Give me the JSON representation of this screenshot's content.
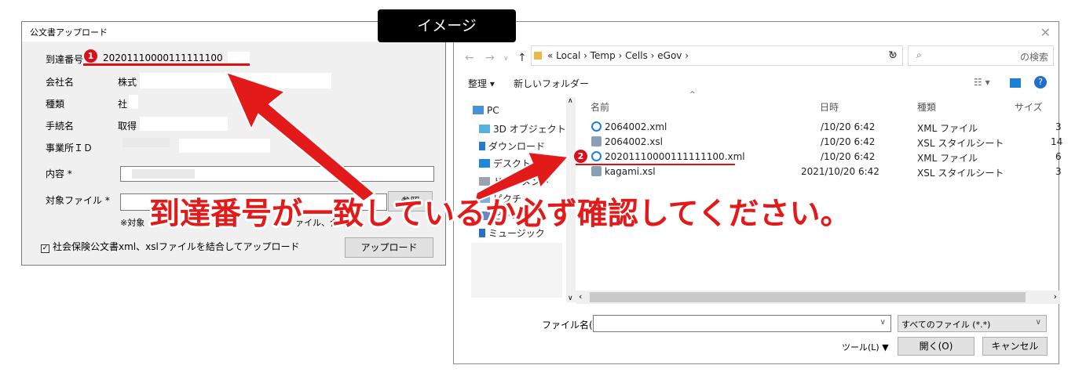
{
  "overlay": {
    "image_tag": "イメージ",
    "headline": "到達番号が一致しているか必ず確認してください。",
    "badge1": "1",
    "badge2": "2"
  },
  "form": {
    "title": "公文書アップロード",
    "arrival_label": "到達番号",
    "arrival_value": "20201110000111111100",
    "company_label": "会社名",
    "company_value": "株式",
    "type_label": "種類",
    "type_value": "社",
    "procedure_label": "手続名",
    "procedure_value": "取得",
    "office_label": "事業所ＩＤ",
    "content_label": "内容 *",
    "target_label": "対象ファイル *",
    "browse_button": "参照",
    "note_left": "※対象",
    "note_right": "ァイル、合計",
    "merge_checkbox_label": "社会保険公文書xml、xslファイルを結合してアップロード",
    "upload_button": "アップロード"
  },
  "dialog": {
    "path": [
      "Local",
      "Temp",
      "Cells",
      "eGov"
    ],
    "path_prefix": "«",
    "search_suffix": "の検索",
    "organize": "整理 ▾",
    "new_folder": "新しいフォルダー",
    "nav_items": [
      "PC",
      "3D オブジェクト",
      "ダウンロード",
      "デスクトップ",
      "ドキュメント",
      "ピクチャ",
      "ビデオ",
      "ミュージック"
    ],
    "columns": {
      "name": "名前",
      "date": "日時",
      "type": "種類",
      "size": "サイズ"
    },
    "files": [
      {
        "name": "2064002.xml",
        "date": "/10/20 6:42",
        "type": "XML ファイル",
        "size": "3"
      },
      {
        "name": "2064002.xsl",
        "date": "/10/20 6:42",
        "type": "XSL スタイルシート",
        "size": "14"
      },
      {
        "name": "20201110000111111100.xml",
        "date": "/10/20 6:42",
        "type": "XML ファイル",
        "size": "6"
      },
      {
        "name": "kagami.xsl",
        "date": "2021/10/20 6:42",
        "type": "XSL スタイルシート",
        "size": "3"
      }
    ],
    "filename_label": "ファイル名(N):",
    "filename_value": "",
    "filetype_value": "すべてのファイル (*.*)",
    "tools": "ツール(L)",
    "open": "開く(O)",
    "cancel": "キャンセル"
  },
  "colors": {
    "accent_red": "#e21a1a",
    "badge_red": "#d8101c",
    "folder_yellow": "#e8b84a",
    "ie_blue": "#1f7fd6"
  }
}
